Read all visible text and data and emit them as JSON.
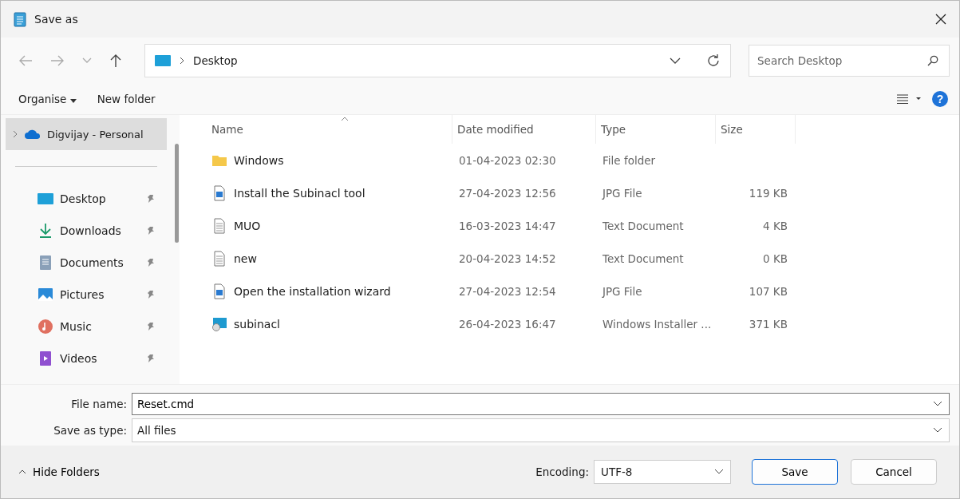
{
  "window": {
    "title": "Save as"
  },
  "address": {
    "location": "Desktop"
  },
  "search": {
    "placeholder": "Search Desktop"
  },
  "toolbar": {
    "organise": "Organise",
    "new_folder": "New folder",
    "help": "?"
  },
  "sidebar": {
    "account": {
      "label": "Digvijay - Personal",
      "selected": true,
      "expanded": false
    },
    "items": [
      {
        "label": "Desktop",
        "kind": "desktop",
        "pinned": true
      },
      {
        "label": "Downloads",
        "kind": "downloads",
        "pinned": true
      },
      {
        "label": "Documents",
        "kind": "documents",
        "pinned": true
      },
      {
        "label": "Pictures",
        "kind": "pictures",
        "pinned": true
      },
      {
        "label": "Music",
        "kind": "music",
        "pinned": true
      },
      {
        "label": "Videos",
        "kind": "videos",
        "pinned": true
      }
    ]
  },
  "table": {
    "columns": [
      "Name",
      "Date modified",
      "Type",
      "Size"
    ],
    "rows": [
      {
        "kind": "folder",
        "name": "Windows",
        "date": "01-04-2023 02:30",
        "type": "File folder"
      },
      {
        "kind": "image",
        "name": "Install the Subinacl tool",
        "date": "27-04-2023 12:56",
        "type": "JPG File",
        "size": "119 KB"
      },
      {
        "kind": "text",
        "name": "MUO",
        "date": "16-03-2023 14:47",
        "type": "Text Document",
        "size": "4 KB"
      },
      {
        "kind": "text",
        "name": "new",
        "date": "20-04-2023 14:52",
        "type": "Text Document",
        "size": "0 KB"
      },
      {
        "kind": "image",
        "name": "Open the installation wizard",
        "date": "27-04-2023 12:54",
        "type": "JPG File",
        "size": "107 KB"
      },
      {
        "kind": "installer",
        "name": "subinacl",
        "date": "26-04-2023 16:47",
        "type": "Windows Installer ...",
        "size": "371 KB"
      }
    ]
  },
  "form": {
    "file_name_label": "File name:",
    "file_name": "Reset.cmd",
    "type_label": "Save as type:",
    "type": "All files"
  },
  "footer": {
    "hide_folders": "Hide Folders",
    "encoding_label": "Encoding:",
    "encoding": "UTF-8",
    "save": "Save",
    "cancel": "Cancel"
  }
}
